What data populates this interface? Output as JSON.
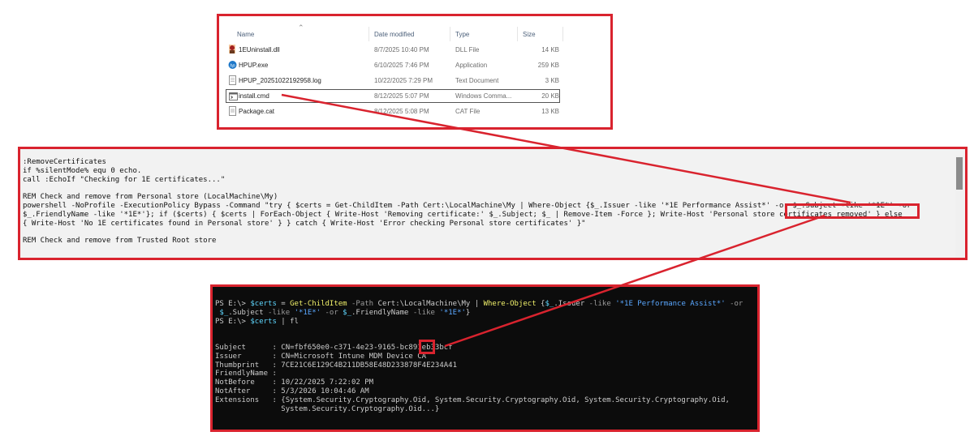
{
  "explorer": {
    "columns": {
      "name": "Name",
      "date": "Date modified",
      "type": "Type",
      "size": "Size"
    },
    "files": [
      {
        "name": "1EUninstall.dll",
        "date": "8/7/2025 10:40 PM",
        "type": "DLL File",
        "size": "14 KB",
        "icon": "dll-file-icon"
      },
      {
        "name": "HPUP.exe",
        "date": "6/10/2025 7:46 PM",
        "type": "Application",
        "size": "259 KB",
        "icon": "hp-logo-icon"
      },
      {
        "name": "HPUP_20251022192958.log",
        "date": "10/22/2025 7:29 PM",
        "type": "Text Document",
        "size": "3 KB",
        "icon": "text-file-icon"
      },
      {
        "name": "install.cmd",
        "date": "8/12/2025 5:07 PM",
        "type": "Windows Comma...",
        "size": "20 KB",
        "icon": "cmd-file-icon",
        "selected": true
      },
      {
        "name": "Package.cat",
        "date": "8/12/2025 5:08 PM",
        "type": "CAT File",
        "size": "13 KB",
        "icon": "cat-file-icon"
      }
    ]
  },
  "script": {
    "lines": [
      ":RemoveCertificates",
      "if %silentMode% equ 0 echo.",
      "call :EchoIf \"Checking for 1E certificates...\"",
      "",
      "REM Check and remove from Personal store (LocalMachine\\My)",
      "powershell -NoProfile -ExecutionPolicy Bypass -Command \"try { $certs = Get-ChildItem -Path Cert:\\LocalMachine\\My | Where-Object {$_.Issuer -like '*1E Performance Assist*' -or $_.Subject -like '*1E*' -or",
      "$_.FriendlyName -like '*1E*'}; if ($certs) { $certs | ForEach-Object { Write-Host 'Removing certificate:' $_.Subject; $_ | Remove-Item -Force }; Write-Host 'Personal store certificates removed' } else",
      "{ Write-Host 'No 1E certificates found in Personal store' } } catch { Write-Host 'Error checking Personal store certificates' }\"",
      "",
      "REM Check and remove from Trusted Root store"
    ]
  },
  "console": {
    "cmd1": {
      "prompt": "PS E:\\> ",
      "var": "$certs",
      "eq": " = ",
      "cmdlet": "Get-ChildItem",
      "p1": " -Path ",
      "path": "Cert:\\LocalMachine\\My",
      "pipe": " | ",
      "where": "Where-Object",
      "open": " {",
      "v1": "$_",
      "issuer": ".Issuer",
      "like1": " -like ",
      "s1": "'*1E Performance Assist*'",
      "or1": " -or",
      "line2_indent": " ",
      "v2": "$_",
      "subject": ".Subject",
      "like2": " -like ",
      "s2": "'*1E*'",
      "or2": " -or ",
      "v3": "$_",
      "friendly": ".FriendlyName",
      "like3": " -like ",
      "s3": "'*1E*'",
      "close": "}"
    },
    "cmd2": {
      "prompt": "PS E:\\> ",
      "var": "$certs",
      "rest": " | fl"
    },
    "output": [
      "Subject      : CN=fbf650e0-c371-4e23-9165-bc891eb33bcf",
      "Issuer       : CN=Microsoft Intune MDM Device CA",
      "Thumbprint   : 7CE21C6E129C4B211DB58E48D233878F4E234A41",
      "FriendlyName :",
      "NotBefore    : 10/22/2025 7:22:02 PM",
      "NotAfter     : 5/3/2026 10:04:46 AM",
      "Extensions   : {System.Security.Cryptography.Oid, System.Security.Cryptography.Oid, System.Security.Cryptography.Oid,",
      "               System.Security.Cryptography.Oid...}"
    ]
  },
  "colors": {
    "highlight": "#d9232e",
    "console_bg": "#0c0c0c",
    "script_bg": "#f2f2f2"
  }
}
